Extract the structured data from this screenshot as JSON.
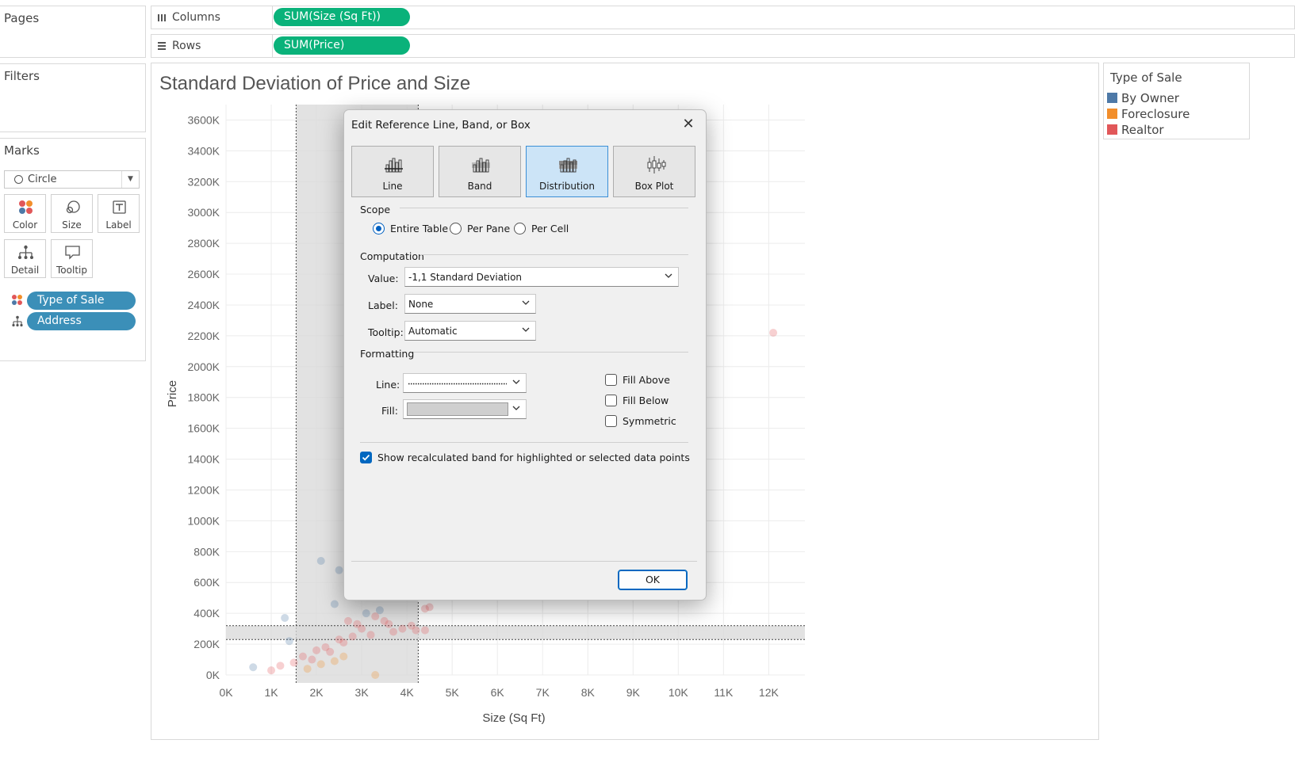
{
  "shelves": {
    "pages_label": "Pages",
    "columns_label": "Columns",
    "columns_pill": "SUM(Size (Sq Ft))",
    "rows_label": "Rows",
    "rows_pill": "SUM(Price)",
    "filters_label": "Filters"
  },
  "marks": {
    "title": "Marks",
    "type": "Circle",
    "buttons": [
      "Color",
      "Size",
      "Label",
      "Detail",
      "Tooltip"
    ],
    "pills": [
      "Type of Sale",
      "Address"
    ]
  },
  "legend": {
    "title": "Type of Sale",
    "items": [
      {
        "label": "By Owner",
        "color": "#4e79a7"
      },
      {
        "label": "Foreclosure",
        "color": "#f28e2b"
      },
      {
        "label": "Realtor",
        "color": "#e15759"
      }
    ]
  },
  "chart_data": {
    "type": "scatter",
    "title": "Standard Deviation of Price and Size",
    "xlabel": "Size (Sq Ft)",
    "ylabel": "Price",
    "x_ticks": [
      "0K",
      "1K",
      "2K",
      "3K",
      "4K",
      "5K",
      "6K",
      "7K",
      "8K",
      "9K",
      "10K",
      "11K",
      "12K"
    ],
    "y_ticks": [
      "0K",
      "200K",
      "400K",
      "600K",
      "800K",
      "1000K",
      "1200K",
      "1400K",
      "1600K",
      "1800K",
      "2000K",
      "2200K",
      "2400K",
      "2600K",
      "2800K",
      "3000K",
      "3200K",
      "3400K",
      "3600K"
    ],
    "xlim": [
      0,
      12800
    ],
    "ylim": [
      0,
      3700000
    ],
    "grid": true,
    "x_band": [
      1550,
      4250
    ],
    "y_band": [
      230000,
      320000
    ],
    "series": [
      {
        "name": "Realtor",
        "color": "#e15759",
        "points": [
          [
            12100,
            2220000
          ],
          [
            4500,
            440000
          ],
          [
            4400,
            430000
          ],
          [
            3300,
            380000
          ],
          [
            3600,
            330000
          ],
          [
            3900,
            300000
          ],
          [
            4200,
            290000
          ],
          [
            4400,
            290000
          ],
          [
            2800,
            250000
          ],
          [
            2500,
            230000
          ],
          [
            2200,
            180000
          ],
          [
            2000,
            160000
          ],
          [
            1700,
            120000
          ],
          [
            1500,
            80000
          ],
          [
            1200,
            60000
          ],
          [
            1000,
            30000
          ],
          [
            3000,
            300000
          ],
          [
            3500,
            350000
          ],
          [
            2600,
            210000
          ],
          [
            3200,
            260000
          ],
          [
            2900,
            330000
          ],
          [
            3700,
            280000
          ],
          [
            4100,
            320000
          ],
          [
            2300,
            150000
          ],
          [
            1900,
            100000
          ],
          [
            2700,
            350000
          ]
        ]
      },
      {
        "name": "By Owner",
        "color": "#4e79a7",
        "points": [
          [
            600,
            50000
          ],
          [
            1300,
            370000
          ],
          [
            2100,
            740000
          ],
          [
            2500,
            680000
          ],
          [
            3100,
            400000
          ],
          [
            3400,
            420000
          ],
          [
            2400,
            460000
          ],
          [
            1400,
            220000
          ],
          [
            2700,
            620000
          ],
          [
            3600,
            520000
          ]
        ]
      },
      {
        "name": "Foreclosure",
        "color": "#f28e2b",
        "points": [
          [
            3300,
            0
          ],
          [
            2100,
            70000
          ],
          [
            2600,
            120000
          ],
          [
            1800,
            40000
          ],
          [
            2400,
            90000
          ]
        ]
      }
    ]
  },
  "dialog": {
    "title": "Edit Reference Line, Band, or Box",
    "tabs": [
      "Line",
      "Band",
      "Distribution",
      "Box Plot"
    ],
    "active_tab": "Distribution",
    "scope_label": "Scope",
    "scope_options": [
      "Entire Table",
      "Per Pane",
      "Per Cell"
    ],
    "scope_selected": "Entire Table",
    "computation_label": "Computation",
    "value_label": "Value:",
    "value": "-1,1 Standard Deviation",
    "label_label": "Label:",
    "label_value": "None",
    "tooltip_label": "Tooltip:",
    "tooltip_value": "Automatic",
    "formatting_label": "Formatting",
    "line_label": "Line:",
    "fill_label": "Fill:",
    "fill_above": "Fill Above",
    "fill_below": "Fill Below",
    "symmetric": "Symmetric",
    "show_recalc": "Show recalculated band for highlighted or selected data points",
    "ok": "OK"
  }
}
